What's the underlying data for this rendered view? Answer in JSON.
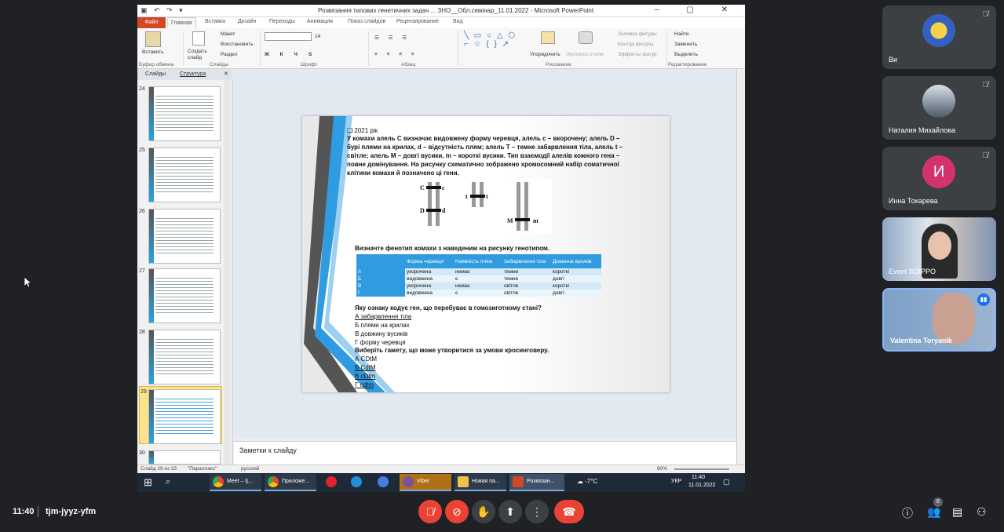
{
  "window": {
    "title": "Розвязання типових генетичних задач ... ЗНО__Обл.семінар_11.01.2022 - Microsoft PowerPoint",
    "qat": "▣ ↶ ↷ ▾",
    "controls": "–  ▢  ✕"
  },
  "ribbon_tabs": [
    "Файл",
    "Главная",
    "Вставка",
    "Дизайн",
    "Переходы",
    "Анимация",
    "Показ слайдов",
    "Рецензирование",
    "Вид"
  ],
  "ribbon": {
    "paste": "Вставить",
    "clipboard": "Буфер обмена",
    "new_slide": "Создать слайд",
    "layout": "Макет",
    "reset": "Восстановить",
    "section": "Раздел",
    "slides_grp": "Слайды",
    "font_grp": "Шрифт",
    "para_grp": "Абзац",
    "arrange": "Упорядочить",
    "quick_styles": "Экспресс-стили",
    "drawing_grp": "Рисование",
    "fill": "Заливка фигуры",
    "outline": "Контур фигуры",
    "effects": "Эффекты фигур",
    "find": "Найти",
    "replace": "Заменить",
    "select": "Выделить",
    "editing_grp": "Редактирование",
    "font_size": "14"
  },
  "left_pane": {
    "tab_slides": "Слайды",
    "tab_outline": "Структура",
    "thumbs": [
      "24",
      "25",
      "26",
      "27",
      "28",
      "29",
      "30"
    ]
  },
  "slide": {
    "year": "2021 рік",
    "task": [
      "У комахи алель С визначає видовжену форму черевця, алель с – вкорочену; алель D –",
      "бурі плями на крилах, d – відсутність плям; алель Т – темне забарвлення тіла, алель  t –",
      "світле; алель М – довгі вусики,  m – короткі вусики.  Тип взаємодії алелів кожного гена –",
      "повне домінування. На рисунку схематично зображено хромосомний набір соматичної",
      "клітини комахи й позначено ці гени."
    ],
    "chrom": {
      "C": "C",
      "c": "c",
      "D": "D",
      "d": "d",
      "t1": "t",
      "t2": "t",
      "M": "M",
      "m": "m"
    },
    "q1": "Визначте фенотип комахи з наведеним на рисунку  генотипом.",
    "table": {
      "headers": [
        "",
        "Форма черевця",
        "Наявність плям",
        "Забарвлення тіла",
        "Довжина вусиків"
      ],
      "rows": [
        [
          "А",
          "укорочена",
          "немає",
          "темне",
          "короткі"
        ],
        [
          "Б",
          "видовжена",
          "є",
          "темне",
          "довгі"
        ],
        [
          "В",
          "укорочена",
          "немає",
          "світле",
          "короткі"
        ],
        [
          "Г",
          "видовжена",
          "є",
          "світле",
          "довгі"
        ]
      ]
    },
    "q2": "Яку ознаку кодує ген, що перебуває  в гомозиготному  стані?",
    "q2_answers": [
      "А забарвлення  тіла",
      "Б плями на крилах",
      "В довжину  вусиків",
      "Г форму  черевця"
    ],
    "q3": "Виберіть гамету, що може утворитися  за умови кросинговеру.",
    "q3_answers": [
      "А CDtM",
      "Б CdtM",
      "В cDtm",
      "Г cdtm"
    ]
  },
  "notes": "Заметки к слайду",
  "status": {
    "slide": "Слайд 29 из 33",
    "theme": "\"Параллакс\"",
    "lang": "русский",
    "zoom": "80%"
  },
  "taskbar": {
    "items": [
      "Meet – tj...",
      "Приложе...",
      "",
      "",
      "",
      "Viber",
      "Новая па...",
      "Розвязан..."
    ],
    "weather": "-7°C",
    "lang": "УКР",
    "time": "11:40",
    "date": "11.01.2022"
  },
  "participants": [
    {
      "name": "Ви"
    },
    {
      "name": "Наталия Михайлова"
    },
    {
      "name": "Инна Токарева",
      "initial": "И"
    },
    {
      "name": "Event SOIPPO"
    },
    {
      "name": "Valentina Toryanik"
    }
  ],
  "meeting": {
    "time": "11:40",
    "code": "tjm-jyyz-yfm",
    "people_count": "6"
  },
  "colors": {
    "accent": "#2f9be0",
    "end_call": "#ea4335",
    "avatar_pink": "#d2336e"
  }
}
